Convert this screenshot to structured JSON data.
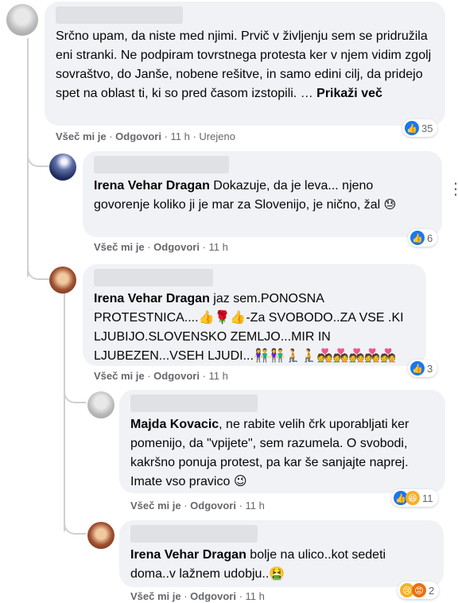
{
  "comments": [
    {
      "author": "",
      "text": "Srčno upam, da niste med njimi. Prvič v življenju sem se pridružila eni stranki. Ne podpiram tovrstnega protesta ker v njem vidim zgolj sovraštvo, do Janše, nobene rešitve, in samo edini cilj, da pridejo spet na oblast ti, ki so pred časom izstopili. …",
      "see_more": "Prikaži več",
      "like_label": "Všeč mi je",
      "reply_label": "Odgovori",
      "time": "11 h",
      "edited": "Urejeno",
      "reaction_count": "35"
    },
    {
      "author": "Irena Vehar Dragan",
      "text": "Dokazuje, da je leva... njeno govorenje koliko ji je mar za Slovenijo, je nično, žal",
      "like_label": "Všeč mi je",
      "reply_label": "Odgovori",
      "time": "11 h",
      "reaction_count": "6"
    },
    {
      "author": "Irena Vehar Dragan",
      "text": "jaz sem.PONOSNA PROTESTNICA....👍🌹👍-Za SVOBODO..ZA VSE .KI LJUBIJO.SLOVENSKO ZEMLJO...MIR IN LJUBEZEN...VSEH LJUDI...👫👫🧎🧎💑💑💑💑💑",
      "like_label": "Všeč mi je",
      "reply_label": "Odgovori",
      "time": "11 h",
      "reaction_count": "3"
    },
    {
      "author": "Majda Kovacic",
      "text": ", ne rabite velih črk uporabljati ker pomenijo, da \"vpijete\", sem razumela. O svobodi, kakršno ponuja protest, pa kar še sanjajte naprej. Imate vso pravico 😉",
      "like_label": "Všeč mi je",
      "reply_label": "Odgovori",
      "time": "11 h",
      "reaction_count": "11"
    },
    {
      "author": "Irena Vehar Dragan",
      "text": "bolje na ulico..kot sedeti doma..v lažnem udobju..🤮",
      "like_label": "Všeč mi je",
      "reply_label": "Odgovori",
      "time": "11 h",
      "reaction_count": "2"
    }
  ],
  "emoji": {
    "sweat": "😓"
  },
  "icons": [
    "like-icon",
    "haha-icon",
    "sad-icon",
    "angry-icon",
    "more-options-icon"
  ],
  "colors": {
    "bubble": "#f0f2f5",
    "meta": "#65676b",
    "like_blue": "#1877f2",
    "thread_line": "#ced0d4"
  }
}
